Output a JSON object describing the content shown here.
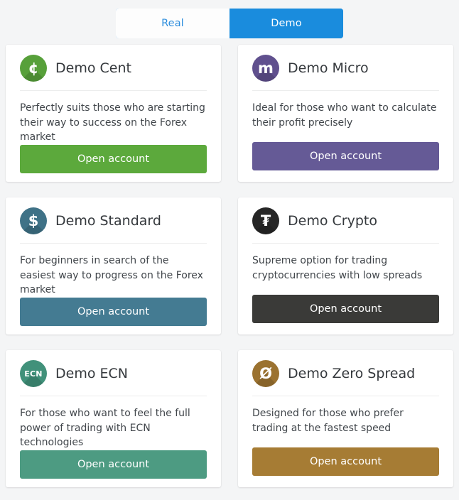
{
  "account_type_toggle": {
    "options": [
      {
        "label": "Real",
        "active": false
      },
      {
        "label": "Demo",
        "active": true
      }
    ],
    "active_color": "#1a8cdd",
    "inactive_text_color": "#2d8ddd"
  },
  "cards": [
    {
      "title": "Demo Cent",
      "icon_name": "cent-icon",
      "icon_glyph": "¢",
      "icon_style": "symbol",
      "icon_color": "#57a03a",
      "description": "Perfectly suits those who are starting their way to success on the Forex market",
      "button_label": "Open account",
      "button_color": "#5ca93c"
    },
    {
      "title": "Demo Micro",
      "icon_name": "micro-icon",
      "icon_glyph": "m",
      "icon_style": "symbol",
      "icon_color": "#60508e",
      "description": "Ideal for those who want to calculate their profit precisely",
      "button_label": "Open account",
      "button_color": "#655a96"
    },
    {
      "title": "Demo Standard",
      "icon_name": "dollar-icon",
      "icon_glyph": "$",
      "icon_style": "symbol",
      "icon_color": "#3f7287",
      "description": "For beginners in search of the easiest way to progress on the Forex market",
      "button_label": "Open account",
      "button_color": "#447b92"
    },
    {
      "title": "Demo Crypto",
      "icon_name": "tether-icon",
      "icon_glyph": "₮",
      "icon_style": "symbol",
      "icon_color": "#262626",
      "description": "Supreme option for trading cryptocurrencies with low spreads",
      "button_label": "Open account",
      "button_color": "#3a3a38"
    },
    {
      "title": "Demo ECN",
      "icon_name": "ecn-icon",
      "icon_glyph": "ECN",
      "icon_style": "text",
      "icon_color": "#41917a",
      "description": "For those who want to feel the full power of trading with ECN technologies",
      "button_label": "Open account",
      "button_color": "#4d9b82"
    },
    {
      "title": "Demo Zero Spread",
      "icon_name": "zero-spread-icon",
      "icon_glyph": "Ø",
      "icon_style": "symbol",
      "icon_color": "#9b7230",
      "description": "Designed for those who prefer trading at the fastest speed",
      "button_label": "Open account",
      "button_color": "#a67c34"
    }
  ]
}
